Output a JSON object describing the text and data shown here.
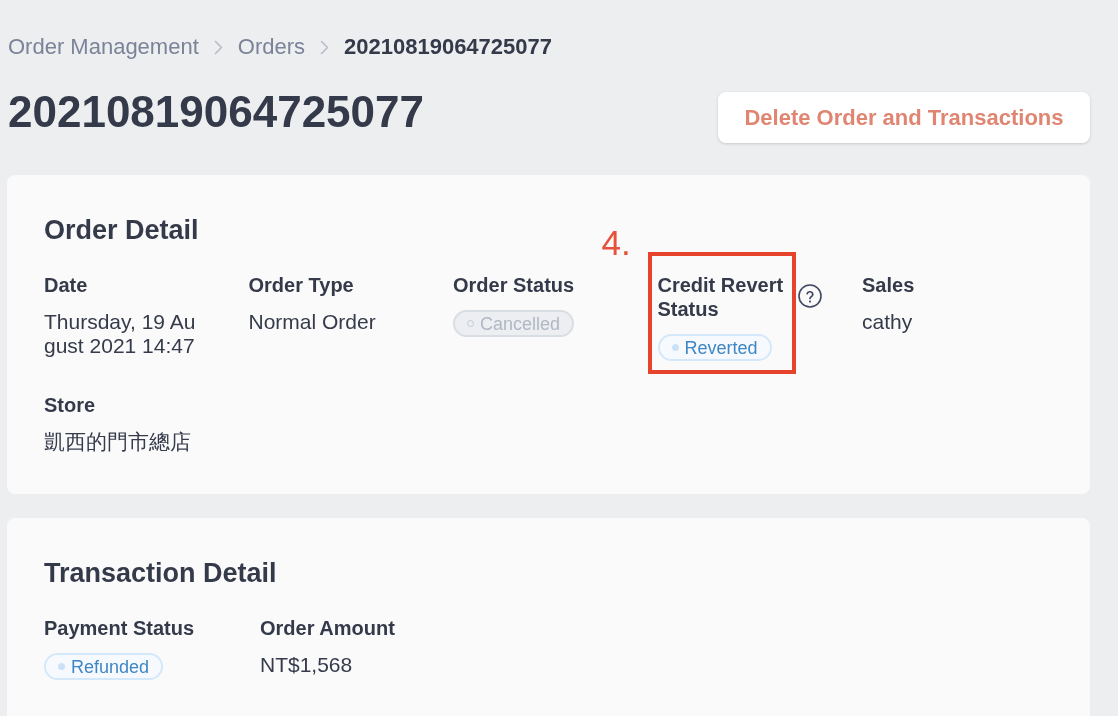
{
  "breadcrumbs": [
    {
      "label": "Order Management",
      "current": false
    },
    {
      "label": "Orders",
      "current": false
    },
    {
      "label": "20210819064725077",
      "current": true
    }
  ],
  "page_title": "20210819064725077",
  "delete_button": {
    "label": "Delete Order and Transactions"
  },
  "order_detail": {
    "title": "Order Detail",
    "fields": [
      {
        "label": "Date",
        "kind": "text",
        "value": "Thursday, 19 August 2021 14:47",
        "help": false,
        "highlighted": false
      },
      {
        "label": "Order Type",
        "kind": "text",
        "value": "Normal Order",
        "help": false,
        "highlighted": false
      },
      {
        "label": "Order Status",
        "kind": "badge",
        "value": "Cancelled",
        "disabled": true,
        "help": false,
        "highlighted": false
      },
      {
        "label": "Credit Revert Status",
        "kind": "badge",
        "value": "Reverted",
        "disabled": false,
        "help": true,
        "highlighted": true,
        "annotation": "4."
      },
      {
        "label": "Sales",
        "kind": "text",
        "value": "cathy",
        "help": false,
        "highlighted": false
      },
      {
        "label": "Store",
        "kind": "text",
        "value": "凱西的門市總店",
        "help": false,
        "highlighted": false
      }
    ]
  },
  "transaction_detail": {
    "title": "Transaction Detail",
    "fields": [
      {
        "label": "Payment Status",
        "kind": "badge",
        "value": "Refunded",
        "disabled": false,
        "help": false,
        "highlighted": false
      },
      {
        "label": "Order Amount",
        "kind": "text",
        "value": "NT$1,568",
        "help": false,
        "highlighted": false
      }
    ]
  }
}
